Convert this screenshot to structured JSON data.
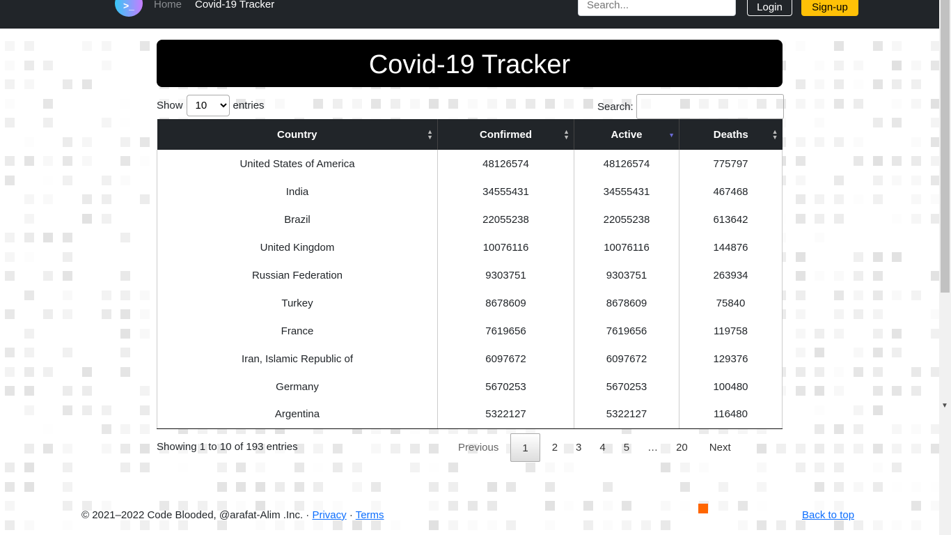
{
  "nav": {
    "brand_icon": "terminal-shield-logo",
    "home": "Home",
    "current": "Covid-19 Tracker",
    "search_placeholder": "Search...",
    "login": "Login",
    "signup": "Sign-up"
  },
  "page": {
    "title": "Covid-19 Tracker"
  },
  "controls": {
    "show": "Show",
    "entries_value": "10",
    "entries": "entries",
    "search": "Search:"
  },
  "table": {
    "headers": [
      "Country",
      "Confirmed",
      "Active",
      "Deaths"
    ],
    "sorted_column": "Active",
    "sort_direction": "descending",
    "rows": [
      [
        "United States of America",
        "48126574",
        "48126574",
        "775797"
      ],
      [
        "India",
        "34555431",
        "34555431",
        "467468"
      ],
      [
        "Brazil",
        "22055238",
        "22055238",
        "613642"
      ],
      [
        "United Kingdom",
        "10076116",
        "10076116",
        "144876"
      ],
      [
        "Russian Federation",
        "9303751",
        "9303751",
        "263934"
      ],
      [
        "Turkey",
        "8678609",
        "8678609",
        "75840"
      ],
      [
        "France",
        "7619656",
        "7619656",
        "119758"
      ],
      [
        "Iran, Islamic Republic of",
        "6097672",
        "6097672",
        "129376"
      ],
      [
        "Germany",
        "5670253",
        "5670253",
        "100480"
      ],
      [
        "Argentina",
        "5322127",
        "5322127",
        "116480"
      ]
    ]
  },
  "info": "Showing 1 to 10 of 193 entries",
  "pagination": {
    "previous": "Previous",
    "pages": [
      "1",
      "2",
      "3",
      "4",
      "5",
      "…",
      "20"
    ],
    "current": "1",
    "next": "Next"
  },
  "footer": {
    "copyright": "© 2021–2022 Code Blooded, @arafat-Alim .Inc. · ",
    "privacy": "Privacy",
    "sep": " · ",
    "terms": "Terms",
    "back_to_top": "Back to top"
  },
  "colors": {
    "navbar": "#212529",
    "signup": "#ffc107",
    "link": "#0d6efd",
    "sort_active": "#6b6bd6"
  }
}
